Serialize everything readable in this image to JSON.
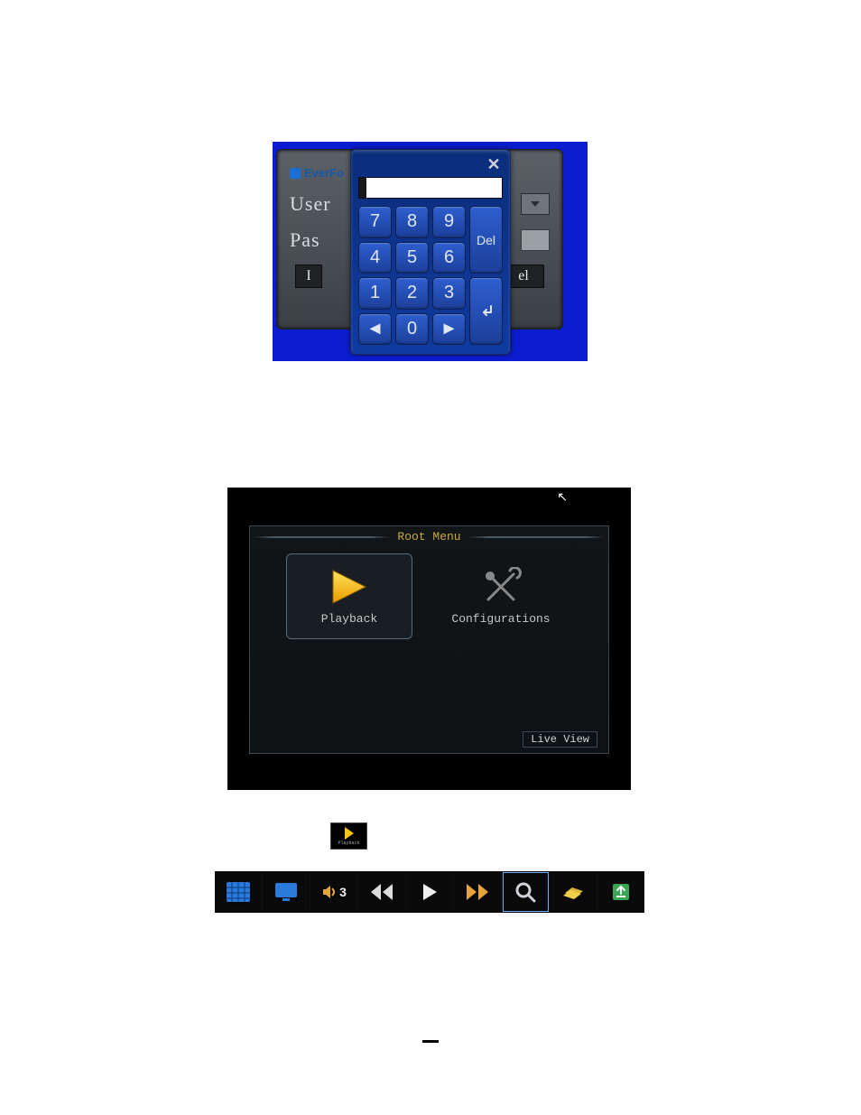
{
  "login": {
    "brand": "EverFo",
    "user_label": "User",
    "pass_label": "Pas",
    "cancel_fragment": "el"
  },
  "keypad": {
    "keys_row0": [
      "7",
      "8",
      "9"
    ],
    "keys_row1": [
      "4",
      "5",
      "6"
    ],
    "keys_row2": [
      "1",
      "2",
      "3"
    ],
    "keys_row3_left": "◄",
    "keys_row3_zero": "0",
    "keys_row3_right": "►",
    "del_label": "Del",
    "enter_label": "↵"
  },
  "root_menu": {
    "title": "Root Menu",
    "playback_label": "Playback",
    "config_label": "Configurations",
    "live_view": "Live View"
  },
  "small_play_label": "Playback",
  "toolbar": {
    "speaker_num": "3"
  }
}
